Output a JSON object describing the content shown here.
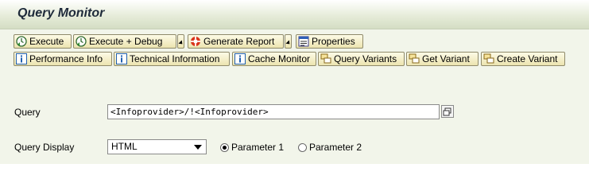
{
  "header": {
    "title": "Query Monitor"
  },
  "toolbar": {
    "row1": [
      {
        "id": "execute",
        "label": "Execute",
        "icon": "clock-run-icon"
      },
      {
        "id": "execute-debug",
        "label": "Execute + Debug",
        "icon": "clock-run-icon",
        "has_dropdown": true
      },
      {
        "id": "generate-report",
        "label": "Generate Report",
        "icon": "lifebuoy-icon",
        "has_dropdown": true
      },
      {
        "id": "properties",
        "label": "Properties",
        "icon": "properties-icon"
      }
    ],
    "row2": [
      {
        "id": "performance-info",
        "label": "Performance Info",
        "icon": "info-icon"
      },
      {
        "id": "technical-information",
        "label": "Technical Information",
        "icon": "info-icon"
      },
      {
        "id": "cache-monitor",
        "label": "Cache Monitor",
        "icon": "info-icon"
      },
      {
        "id": "query-variants",
        "label": "Query Variants",
        "icon": "variant-icon"
      },
      {
        "id": "get-variant",
        "label": "Get Variant",
        "icon": "variant-icon"
      },
      {
        "id": "create-variant",
        "label": "Create Variant",
        "icon": "variant-icon"
      }
    ]
  },
  "form": {
    "query_label": "Query",
    "query_value": "<Infoprovider>/!<Infoprovider>",
    "display_label": "Query Display",
    "display_value": "HTML",
    "radio_options": [
      {
        "label": "Parameter 1",
        "selected": true
      },
      {
        "label": "Parameter 2",
        "selected": false
      }
    ]
  },
  "colors": {
    "button_top": "#fdfbe6",
    "button_bottom": "#ece4b0",
    "title_bg": "#e6ecd9",
    "info_icon": "#1f5fb0"
  }
}
